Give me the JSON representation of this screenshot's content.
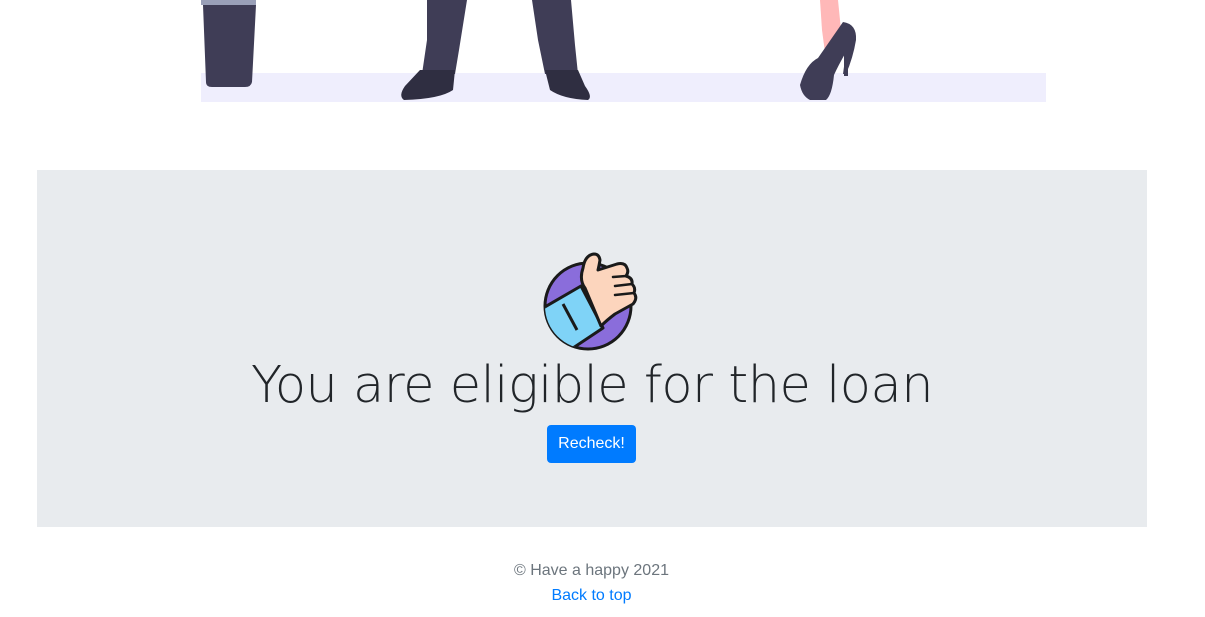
{
  "illustration": {
    "name": "people-standing-illustration",
    "floor_color": "#efeefd",
    "figure_color": "#3f3d56",
    "skin_color": "#ffb8b8"
  },
  "result": {
    "icon": "thumbs-up-icon",
    "headline": "You are eligible for the loan",
    "recheck_label": "Recheck!",
    "accent_color": "#007bff",
    "panel_color": "#e8ebee"
  },
  "footer": {
    "copyright": "© Have a happy 2021",
    "back_to_top": "Back to top"
  }
}
